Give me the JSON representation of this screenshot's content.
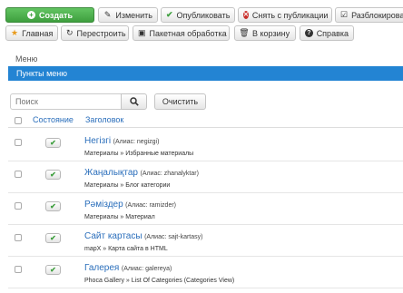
{
  "toolbar": {
    "row1": {
      "create": "Создать",
      "edit": "Изменить",
      "publish": "Опубликовать",
      "unpublish": "Снять с публикации",
      "unlock": "Разблокировать"
    },
    "row2": {
      "home": "Главная",
      "rebuild": "Перестроить",
      "batch": "Пакетная обработка",
      "trash": "В корзину",
      "help": "Справка"
    }
  },
  "sidebar": {
    "items": [
      {
        "label": "Меню",
        "active": false
      },
      {
        "label": "Пункты меню",
        "active": true
      }
    ]
  },
  "filter": {
    "search_placeholder": "Поиск",
    "clear_label": "Очистить"
  },
  "table": {
    "headers": {
      "status": "Состояние",
      "title": "Заголовок"
    },
    "rows": [
      {
        "title": "Негізгі",
        "alias": "(Алиас: negizgi)",
        "type": "Материалы » Избранные материалы",
        "published": true
      },
      {
        "title": "Жаңалықтар",
        "alias": "(Алиас: zhanalyktar)",
        "type": "Материалы » Блог категории",
        "published": true
      },
      {
        "title": "Рәміздер",
        "alias": "(Алиас: ramizder)",
        "type": "Материалы » Материал",
        "published": true
      },
      {
        "title": "Сайт картасы",
        "alias": "(Алиас: sajt-kartasy)",
        "type": "mapX » Карта сайта в HTML",
        "published": true
      },
      {
        "title": "Галерея",
        "alias": "(Алиас: galereya)",
        "type": "Phoca Gallery » List Of Categories (Categories View)",
        "published": true
      }
    ]
  },
  "colors": {
    "accent": "#2384d3",
    "success": "#3e9f3e",
    "danger": "#c9302c",
    "link": "#2a6ebb"
  }
}
